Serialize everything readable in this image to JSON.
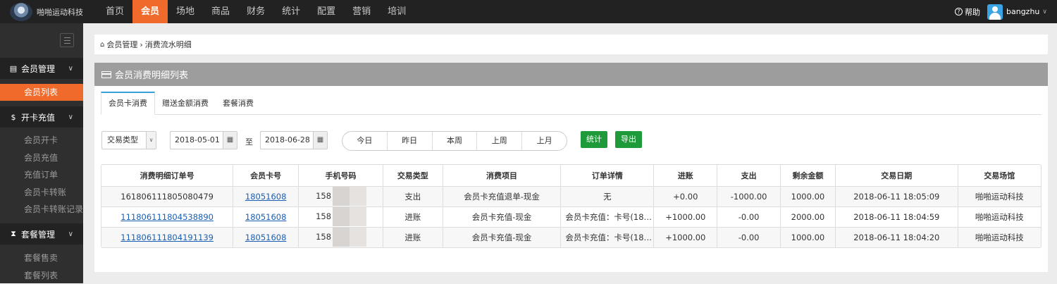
{
  "app": {
    "name": "啪啪运动科技"
  },
  "nav": {
    "items": [
      "首页",
      "会员",
      "场地",
      "商品",
      "财务",
      "统计",
      "配置",
      "营销",
      "培训"
    ],
    "active": "会员"
  },
  "header": {
    "help": "帮助",
    "user": "bangzhu"
  },
  "sidebar": {
    "groups": [
      {
        "label": "会员管理",
        "icon": "id-card-icon",
        "items": [
          "会员列表"
        ]
      },
      {
        "label": "开卡充值",
        "icon": "dollar-icon",
        "items": [
          "会员开卡",
          "会员充值",
          "充值订单",
          "会员卡转账",
          "会员卡转账记录"
        ]
      },
      {
        "label": "套餐管理",
        "icon": "hourglass-icon",
        "items": [
          "套餐售卖",
          "套餐列表"
        ]
      }
    ],
    "active_item": "会员列表"
  },
  "breadcrumb": {
    "root": "会员管理",
    "separator": "›",
    "current": "消费流水明细"
  },
  "panel": {
    "title": "会员消费明细列表"
  },
  "tabs": [
    "会员卡消费",
    "赠送金额消费",
    "套餐消费"
  ],
  "filters": {
    "type_select": "交易类型",
    "start_date": "2018-05-01",
    "to": "至",
    "end_date": "2018-06-28",
    "quick": [
      "今日",
      "昨日",
      "本周",
      "上周",
      "上月"
    ],
    "stat_button": "统计",
    "export_button": "导出"
  },
  "table": {
    "columns": [
      "消费明细订单号",
      "会员卡号",
      "手机号码",
      "交易类型",
      "消费项目",
      "订单详情",
      "进账",
      "支出",
      "剩余金额",
      "交易日期",
      "交易场馆"
    ],
    "rows": [
      [
        "161806111805080479",
        "18051608",
        "158",
        "支出",
        "会员卡充值退单-现金",
        "无",
        "+0.00",
        "-1000.00",
        "1000.00",
        "2018-06-11 18:05:09",
        "啪啪运动科技"
      ],
      [
        "111806111804538890",
        "18051608",
        "158",
        "进账",
        "会员卡充值-现金",
        "会员卡充值：卡号(18…",
        "+1000.00",
        "-0.00",
        "2000.00",
        "2018-06-11 18:04:59",
        "啪啪运动科技"
      ],
      [
        "111806111804191139",
        "18051608",
        "158",
        "进账",
        "会员卡充值-现金",
        "会员卡充值：卡号(18…",
        "+1000.00",
        "-0.00",
        "1000.00",
        "2018-06-11 18:04:20",
        "啪啪运动科技"
      ]
    ]
  },
  "colors": {
    "accent": "#f06a2b",
    "topbar": "#222222",
    "sidebar": "#2f2f2f",
    "button_green": "#1f9a3a",
    "tab_active": "#3aa0dc",
    "link": "#1a5fb4"
  }
}
